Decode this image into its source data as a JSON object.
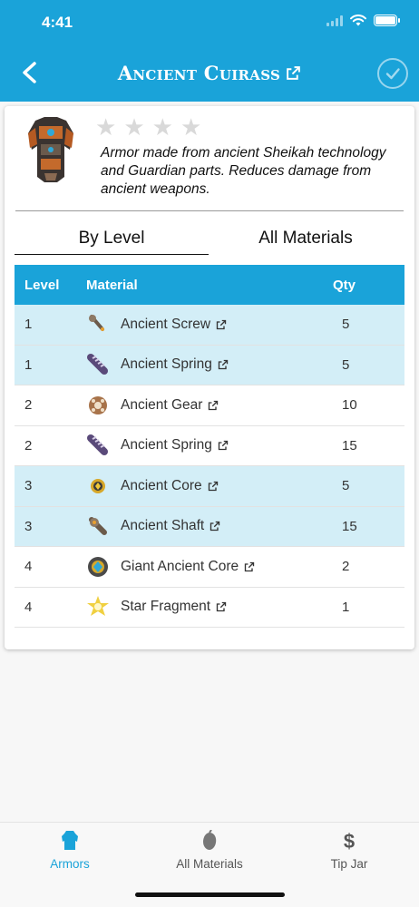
{
  "status_bar": {
    "time": "4:41"
  },
  "header": {
    "title": "Ancient Cuirass"
  },
  "item": {
    "rating_max": 4,
    "rating": 0,
    "description": "Armor made from ancient Sheikah technology and Guardian parts. Reduces damage from ancient weapons."
  },
  "tabs": [
    {
      "label": "By Level",
      "active": true
    },
    {
      "label": "All Materials",
      "active": false
    }
  ],
  "table": {
    "headers": {
      "level": "Level",
      "material": "Material",
      "qty": "Qty"
    },
    "rows": [
      {
        "level": "1",
        "material": "Ancient Screw",
        "qty": "5",
        "icon": "screw-icon",
        "highlight": true
      },
      {
        "level": "1",
        "material": "Ancient Spring",
        "qty": "5",
        "icon": "spring-icon",
        "highlight": true
      },
      {
        "level": "2",
        "material": "Ancient Gear",
        "qty": "10",
        "icon": "gear-icon",
        "highlight": false
      },
      {
        "level": "2",
        "material": "Ancient Spring",
        "qty": "15",
        "icon": "spring-icon",
        "highlight": false
      },
      {
        "level": "3",
        "material": "Ancient Core",
        "qty": "5",
        "icon": "core-icon",
        "highlight": true
      },
      {
        "level": "3",
        "material": "Ancient Shaft",
        "qty": "15",
        "icon": "shaft-icon",
        "highlight": true
      },
      {
        "level": "4",
        "material": "Giant Ancient Core",
        "qty": "2",
        "icon": "giant-core-icon",
        "highlight": false
      },
      {
        "level": "4",
        "material": "Star Fragment",
        "qty": "1",
        "icon": "star-fragment-icon",
        "highlight": false
      }
    ]
  },
  "tab_bar": {
    "items": [
      {
        "label": "Armors",
        "icon": "armor-icon",
        "active": true
      },
      {
        "label": "All Materials",
        "icon": "material-icon",
        "active": false
      },
      {
        "label": "Tip Jar",
        "icon": "dollar-icon",
        "active": false
      }
    ]
  },
  "colors": {
    "accent": "#1aa3d9",
    "row_highlight": "#d3eef7",
    "inactive": "#666666"
  }
}
